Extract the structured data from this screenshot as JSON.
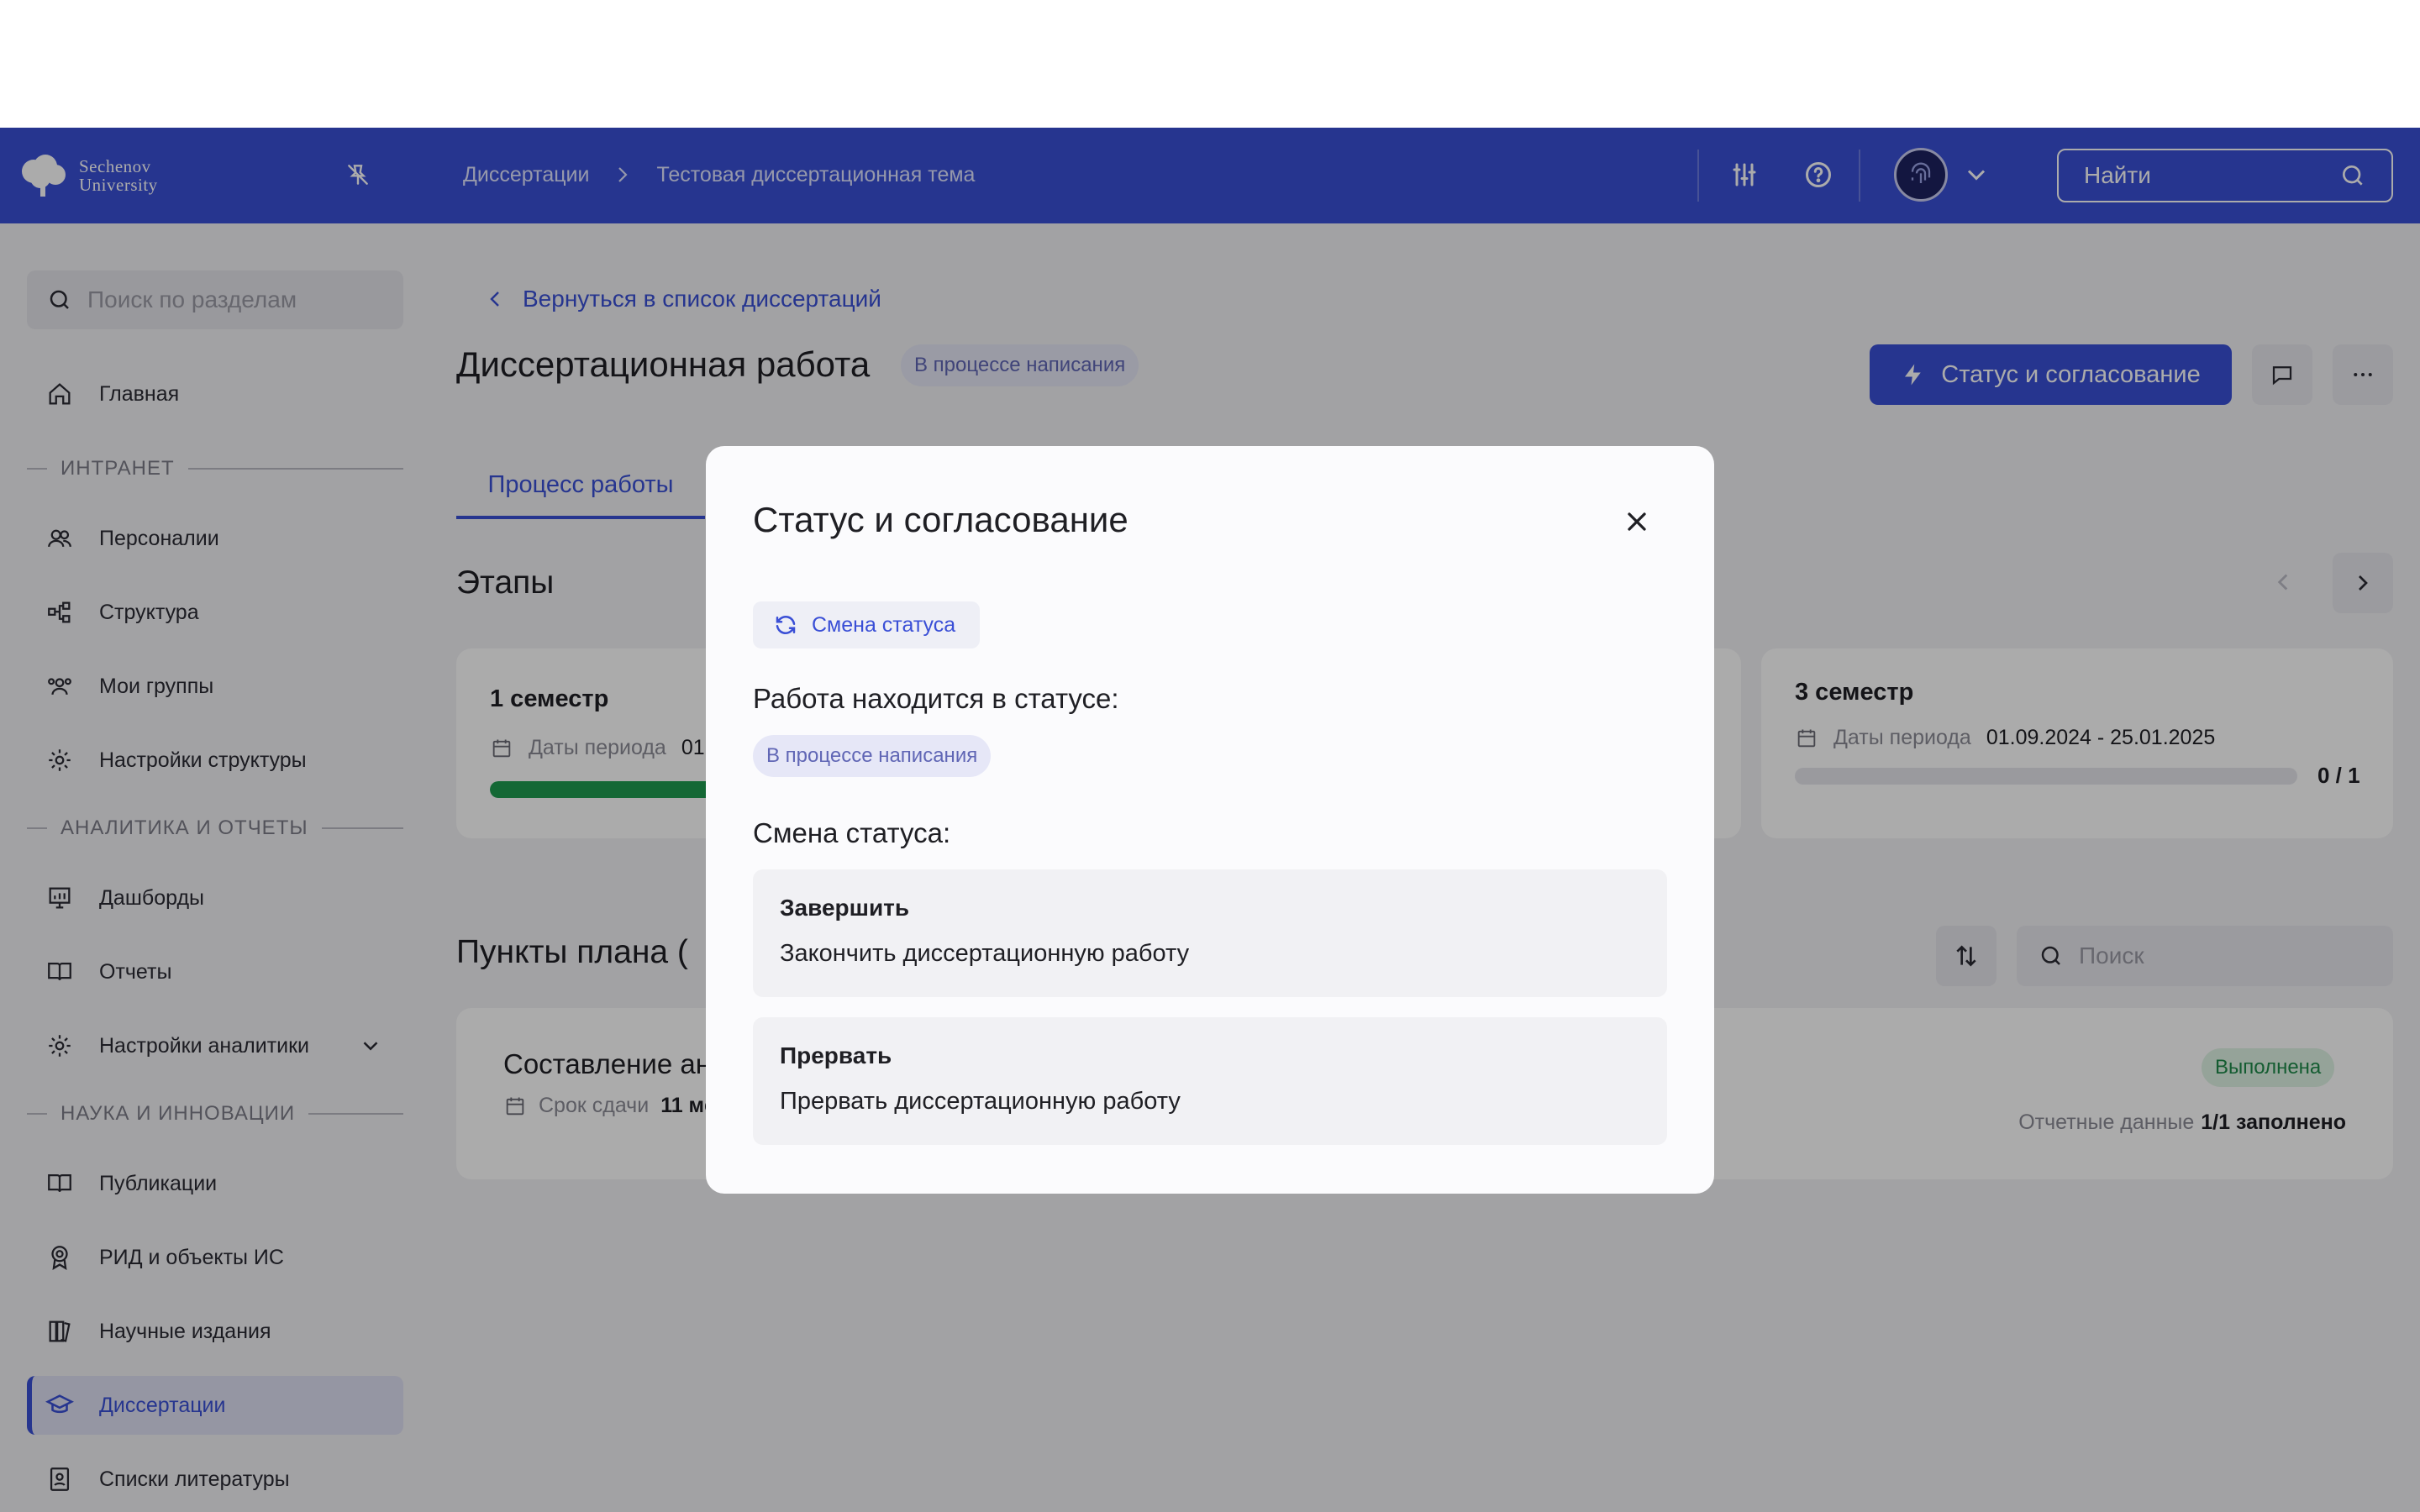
{
  "header": {
    "logo_line1": "Sechenov",
    "logo_line2": "University",
    "breadcrumbs": [
      "Диссертации",
      "Тестовая диссертационная тема"
    ],
    "search_placeholder": "Найти"
  },
  "sidebar": {
    "search_placeholder": "Поиск по разделам",
    "items": [
      {
        "label": "Главная",
        "icon": "home-icon"
      },
      {
        "section": "ИНТРАНЕТ"
      },
      {
        "label": "Персоналии",
        "icon": "people-icon"
      },
      {
        "label": "Структура",
        "icon": "structure-icon"
      },
      {
        "label": "Мои группы",
        "icon": "groups-icon"
      },
      {
        "label": "Настройки структуры",
        "icon": "gear-icon"
      },
      {
        "section": "АНАЛИТИКА И ОТЧЕТЫ"
      },
      {
        "label": "Дашборды",
        "icon": "dashboard-icon"
      },
      {
        "label": "Отчеты",
        "icon": "book-icon"
      },
      {
        "label": "Настройки аналитики",
        "icon": "gear-icon"
      },
      {
        "section": "НАУКА И ИННОВАЦИИ"
      },
      {
        "label": "Публикации",
        "icon": "book-icon"
      },
      {
        "label": "РИД и объекты ИС",
        "icon": "award-icon"
      },
      {
        "label": "Научные издания",
        "icon": "books-icon"
      },
      {
        "label": "Диссертации",
        "icon": "graduation-cap-icon",
        "active": true
      },
      {
        "label": "Списки литературы",
        "icon": "contacts-book-icon"
      }
    ]
  },
  "main": {
    "back_link": "Вернуться в список диссертаций",
    "title": "Диссертационная работа",
    "title_badge": "В процессе написания",
    "status_button": "Статус и согласование",
    "tab_active": "Процесс работы",
    "stages_title": "Этапы",
    "stage1": {
      "name": "1 семестр",
      "dates_label": "Даты периода",
      "dates_value_partial": "01",
      "progress": 0.6
    },
    "stage3": {
      "name": "3 семестр",
      "dates_label": "Даты периода",
      "dates_value": "01.09.2024 - 25.01.2025",
      "count": "0 / 1",
      "progress": 0
    },
    "plan_title": "Пункты плана (",
    "search_placeholder": "Поиск",
    "plan_item": {
      "title_partial": "Составление ан",
      "due_label": "Срок сдачи",
      "due_value_partial": "11 ме",
      "status": "Выполнена",
      "report_label": "Отчетные данные",
      "report_value": "1/1 заполнено"
    }
  },
  "modal": {
    "title": "Статус и согласование",
    "chip": "Смена статуса",
    "current_label": "Работа находится в статусе:",
    "current_status": "В процессе написания",
    "change_label": "Смена статуса:",
    "options": [
      {
        "title": "Завершить",
        "description": "Закончить диссертационную работу"
      },
      {
        "title": "Прервать",
        "description": "Прервать диссертационную работу"
      }
    ]
  },
  "colors": {
    "brand": "#3a4fd6",
    "success": "#1e9b4f"
  }
}
